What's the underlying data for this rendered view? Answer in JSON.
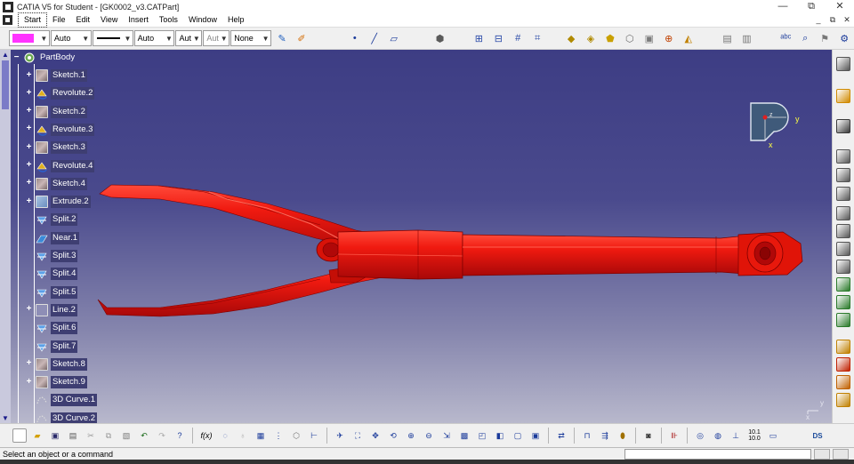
{
  "window": {
    "title": "CATIA V5 for Student - [GK0002_v3.CATPart]",
    "controls": {
      "minimize": "—",
      "restore": "⧉",
      "close": "✕"
    }
  },
  "menu": {
    "items": [
      "Start",
      "File",
      "Edit",
      "View",
      "Insert",
      "Tools",
      "Window",
      "Help"
    ],
    "doc_controls": {
      "minimize": "_",
      "restore": "⧉",
      "close": "✕"
    }
  },
  "toolbar": {
    "color_combo": {
      "value": "",
      "color": "#ff33ff"
    },
    "transparency_combo": {
      "value": "Auto"
    },
    "linetype_combo": {
      "value": ""
    },
    "thickness_combo": {
      "value": "Auto"
    },
    "point_combo": {
      "value": "Aut"
    },
    "layer_combo": {
      "value": "Aut"
    },
    "filter_combo": {
      "value": "None"
    }
  },
  "spec_tree": {
    "root": "PartBody",
    "nodes": [
      {
        "label": "Sketch.1",
        "icon": "sketch-icon",
        "expand": true
      },
      {
        "label": "Revolute.2",
        "icon": "revolute-icon",
        "expand": true
      },
      {
        "label": "Sketch.2",
        "icon": "sketch-icon",
        "expand": true
      },
      {
        "label": "Revolute.3",
        "icon": "revolute-icon",
        "expand": true
      },
      {
        "label": "Sketch.3",
        "icon": "sketch-icon",
        "expand": true
      },
      {
        "label": "Revolute.4",
        "icon": "revolute-icon",
        "expand": true
      },
      {
        "label": "Sketch.4",
        "icon": "sketch-icon",
        "expand": true
      },
      {
        "label": "Extrude.2",
        "icon": "extrude-icon",
        "expand": true
      },
      {
        "label": "Split.2",
        "icon": "split-icon",
        "expand": false
      },
      {
        "label": "Near.1",
        "icon": "near-icon",
        "expand": false
      },
      {
        "label": "Split.3",
        "icon": "split-icon",
        "expand": false
      },
      {
        "label": "Split.4",
        "icon": "split-icon",
        "expand": false
      },
      {
        "label": "Split.5",
        "icon": "split-icon",
        "expand": false
      },
      {
        "label": "Line.2",
        "icon": "line-icon",
        "expand": true
      },
      {
        "label": "Split.6",
        "icon": "split-icon",
        "expand": false
      },
      {
        "label": "Split.7",
        "icon": "split-icon",
        "expand": false
      },
      {
        "label": "Sketch.8",
        "icon": "sketch-icon",
        "expand": true
      },
      {
        "label": "Sketch.9",
        "icon": "sketch-icon",
        "expand": true
      },
      {
        "label": "3D Curve.1",
        "icon": "curve-icon",
        "expand": false
      },
      {
        "label": "3D Curve.2",
        "icon": "curve-icon",
        "expand": false
      }
    ]
  },
  "compass": {
    "x_label": "x",
    "y_label": "y",
    "z_label": "z"
  },
  "axis_triad": {
    "x_label": "x",
    "y_label": "y"
  },
  "model": {
    "color": "#e01010",
    "name": "bicycle fork part"
  },
  "bottom_toolbar": {
    "fx_label": "f(x)",
    "units_label": "10.1\n10.0"
  },
  "status": {
    "message": "Select an object or a command",
    "command_value": ""
  }
}
